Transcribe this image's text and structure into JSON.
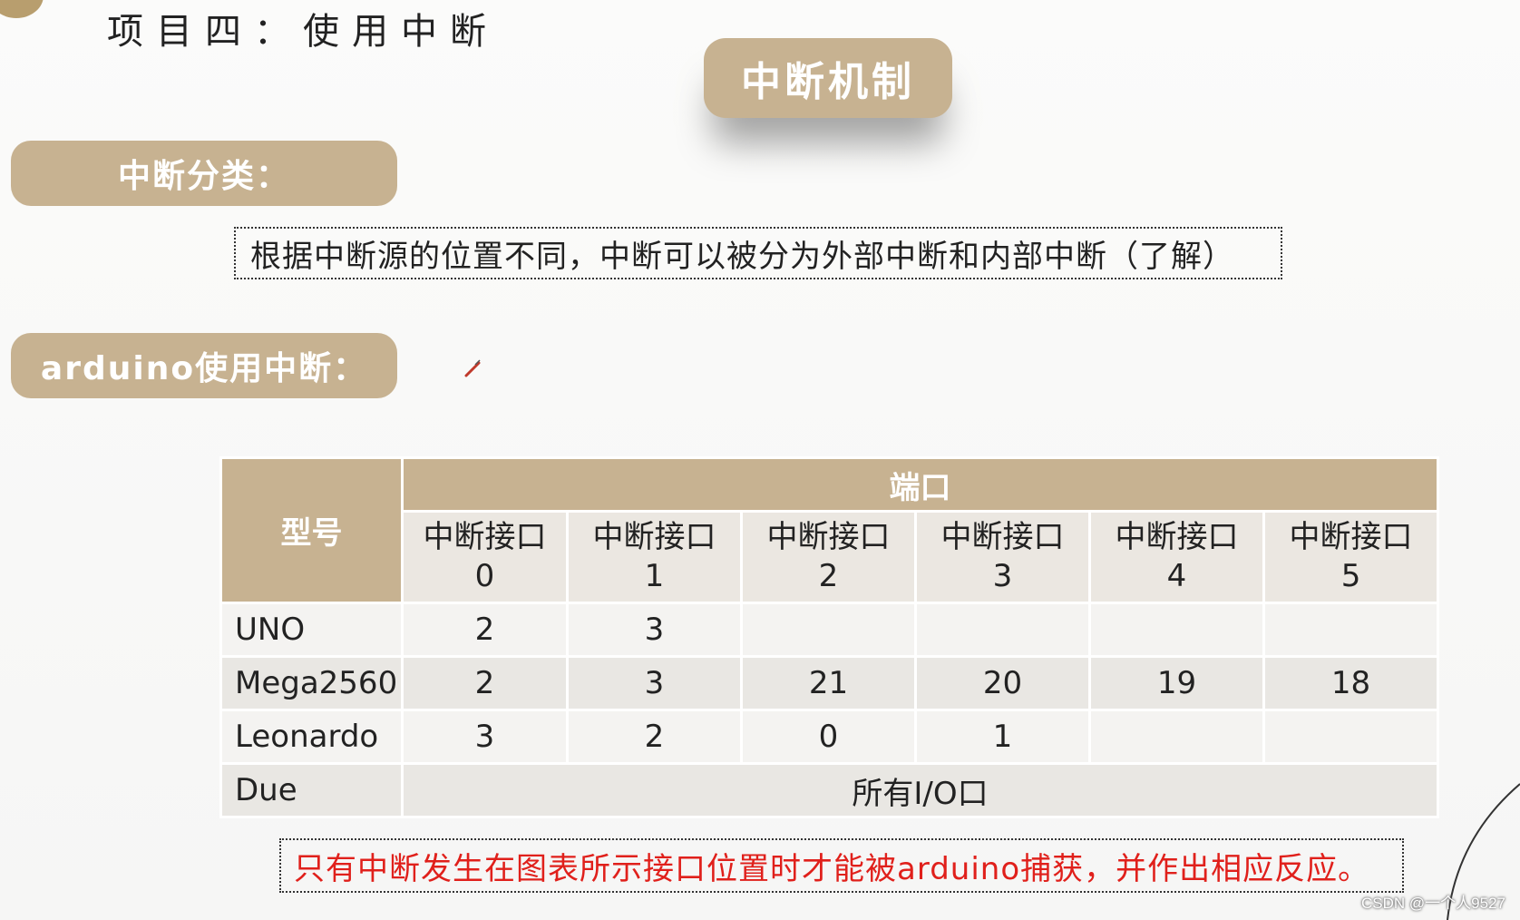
{
  "header": {
    "project_title": "项目四：使用中断",
    "main_title": "中断机制"
  },
  "sections": {
    "classification_label": "中断分类：",
    "classification_text": "根据中断源的位置不同，中断可以被分为外部中断和内部中断（了解）",
    "arduino_label": "arduino使用中断："
  },
  "table": {
    "model_header": "型号",
    "ports_header": "端口",
    "sub_headers": [
      {
        "name": "中断接口",
        "num": "0"
      },
      {
        "name": "中断接口",
        "num": "1"
      },
      {
        "name": "中断接口",
        "num": "2"
      },
      {
        "name": "中断接口",
        "num": "3"
      },
      {
        "name": "中断接口",
        "num": "4"
      },
      {
        "name": "中断接口",
        "num": "5"
      }
    ],
    "rows": [
      {
        "model": "UNO",
        "ports": [
          "2",
          "3",
          "",
          "",
          "",
          ""
        ]
      },
      {
        "model": "Mega2560",
        "ports": [
          "2",
          "3",
          "21",
          "20",
          "19",
          "18"
        ]
      },
      {
        "model": "Leonardo",
        "ports": [
          "3",
          "2",
          "0",
          "1",
          "",
          ""
        ]
      },
      {
        "model": "Due",
        "all_ports": "所有I/O口"
      }
    ]
  },
  "note": "只有中断发生在图表所示接口位置时才能被arduino捕获，并作出相应反应。",
  "watermark": "CSDN @一个人9527",
  "icons": {
    "pen": "pen-icon"
  },
  "colors": {
    "accent": "#c7b291",
    "note_text": "#e0201b"
  }
}
